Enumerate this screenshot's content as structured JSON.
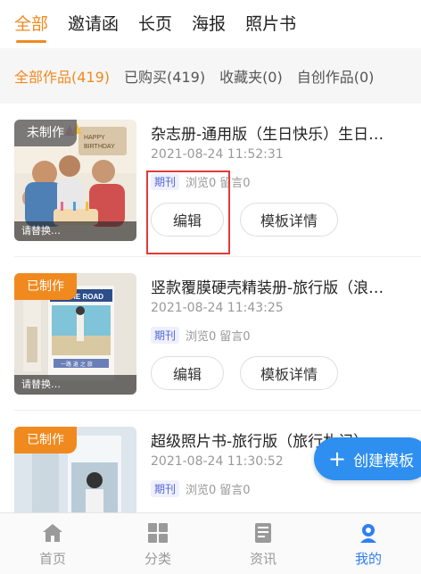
{
  "top_tabs": [
    "全部",
    "邀请函",
    "长页",
    "海报",
    "照片书"
  ],
  "sub_tabs": [
    "全部作品(419)",
    "已购买(419)",
    "收藏夹(0)",
    "自创作品(0)"
  ],
  "cards": [
    {
      "badge": "未制作",
      "title": "杂志册-通用版（生日快乐）生日…",
      "time": "2021-08-24 11:52:31",
      "tag": "期刊",
      "views": "浏览0",
      "comments": "留言0",
      "edit": "编辑",
      "detail": "模板详情",
      "caption": "请替换…"
    },
    {
      "badge": "已制作",
      "title": "竖款覆膜硬壳精装册-旅行版（浪…",
      "time": "2021-08-24 11:43:25",
      "tag": "期刊",
      "views": "浏览0",
      "comments": "留言0",
      "edit": "编辑",
      "detail": "模板详情",
      "caption": "请替换…",
      "thumb_text": "ON THE ROAD",
      "thumb_sub": "一路 逍 之 旅"
    },
    {
      "badge": "已制作",
      "title": "超级照片书-旅行版（旅行札记）",
      "time": "2021-08-24 11:30:52",
      "tag": "期刊",
      "views": "浏览0",
      "comments": "留言0"
    }
  ],
  "fab_label": "创建模板",
  "bottom_nav": [
    "首页",
    "分类",
    "资讯",
    "我的"
  ],
  "colors": {
    "accent": "#f08a1f",
    "blue": "#2e8ff0",
    "highlight": "#e03a3a"
  }
}
